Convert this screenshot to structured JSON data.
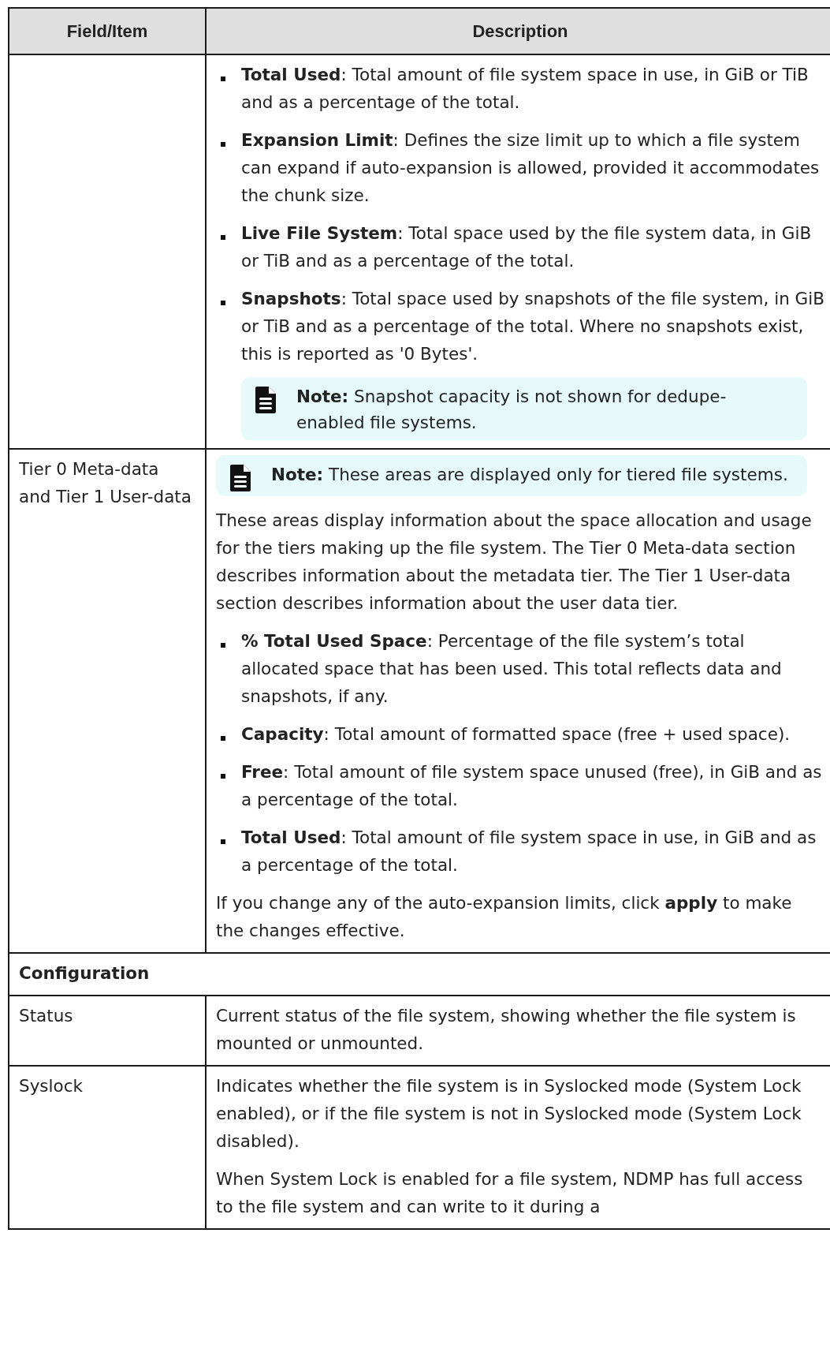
{
  "table": {
    "columns": [
      "Field/Item",
      "Description"
    ],
    "rows": [
      {
        "kind": "row",
        "description": [
          {
            "kind": "bullets",
            "items": [
              {
                "text": "**Total Used**: Total amount of file system space in use, in GiB or TiB and as a percentage of the total."
              },
              {
                "text": "**Expansion Limit**: Defines the size limit up to which a file system can expand if auto-expansion is allowed, provided it accommodates the chunk size."
              },
              {
                "text": "**Live File System**: Total space used by the file system data, in GiB or TiB and as a percentage of the total."
              },
              {
                "text": "**Snapshots**: Total space used by snapshots of the file system, in GiB or TiB and as a percentage of the total. Where no snapshots exist, this is reported as '0 Bytes'.",
                "notes": [
                  {
                    "text": "**Note:** Snapshot capacity is not shown for dedupe-enabled file systems."
                  }
                ]
              }
            ]
          }
        ]
      },
      {
        "kind": "row",
        "field": "Tier 0 Meta-data and Tier 1 User-data",
        "description": [
          {
            "kind": "note",
            "text": "**Note:** These areas are displayed only for tiered file systems."
          },
          {
            "kind": "para",
            "text": "These areas display information about the space allocation and usage for the tiers making up the file system. The Tier 0 Meta-data section describes information about the metadata tier. The Tier 1 User-data section describes information about the user data tier."
          },
          {
            "kind": "bullets",
            "items": [
              {
                "text": "**% Total Used Space**: Percentage of the file system’s total allocated space that has been used. This total reflects data and snapshots, if any."
              },
              {
                "text": "**Capacity**: Total amount of formatted space (free + used space)."
              },
              {
                "text": "**Free**: Total amount of file system space unused (free), in GiB and as a percentage of the total."
              },
              {
                "text": "**Total Used**: Total amount of file system space in use, in GiB and as a percentage of the total."
              }
            ]
          },
          {
            "kind": "para",
            "text": "If you change any of the auto-expansion limits, click **apply** to make the changes effective."
          }
        ]
      },
      {
        "kind": "section",
        "title": "Configuration"
      },
      {
        "kind": "row",
        "field": "Status",
        "description": [
          {
            "kind": "para",
            "text": "Current status of the file system, showing whether the file system is mounted or unmounted."
          }
        ]
      },
      {
        "kind": "row",
        "field": "Syslock",
        "description": [
          {
            "kind": "para",
            "text": "Indicates whether the file system is in Syslocked mode (System Lock enabled), or if the file system is not in Syslocked mode (System Lock disabled)."
          },
          {
            "kind": "para",
            "text": "When System Lock is enabled for a file system, NDMP has full access to the file system and can write to it during a"
          }
        ]
      }
    ]
  }
}
